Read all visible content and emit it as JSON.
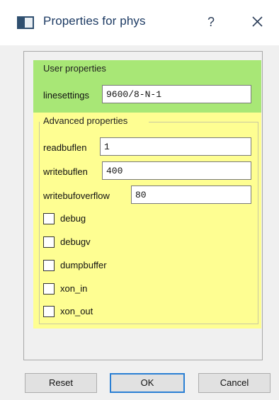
{
  "window": {
    "title": "Properties for phys",
    "help_label": "?"
  },
  "user_group": {
    "title": "User properties",
    "fields": [
      {
        "label": "linesettings",
        "value": "9600/8-N-1"
      }
    ]
  },
  "advanced_group": {
    "title": "Advanced properties",
    "fields": [
      {
        "label": "readbuflen",
        "value": "1"
      },
      {
        "label": "writebuflen",
        "value": "400"
      },
      {
        "label": "writebufoverflow",
        "value": "80"
      }
    ],
    "checkboxes": [
      {
        "label": "debug",
        "checked": false
      },
      {
        "label": "debugv",
        "checked": false
      },
      {
        "label": "dumpbuffer",
        "checked": false
      },
      {
        "label": "xon_in",
        "checked": false
      },
      {
        "label": "xon_out",
        "checked": false
      }
    ]
  },
  "buttons": {
    "reset": "Reset",
    "ok": "OK",
    "cancel": "Cancel"
  },
  "colors": {
    "user_group_bg": "#a8e776",
    "advanced_group_bg": "#fefe92",
    "default_button_border": "#2a7fd4",
    "title_text": "#1c3a63"
  },
  "icons": {
    "app": "window-properties-icon",
    "close": "close-icon"
  }
}
